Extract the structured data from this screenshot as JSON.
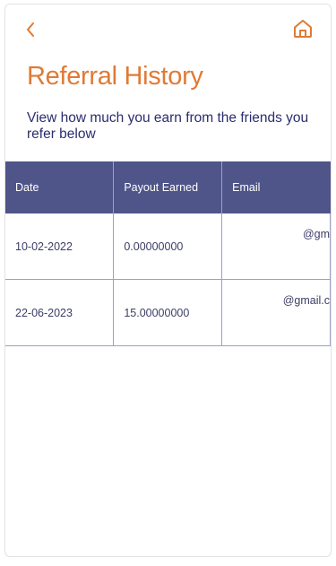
{
  "header": {
    "back_icon": "chevron-left-icon",
    "home_icon": "home-icon",
    "accent_color": "#e07a35"
  },
  "title": "Referral History",
  "subtitle": "View how much you earn from the friends you refer below",
  "table": {
    "columns": [
      "Date",
      "Payout Earned",
      "Email"
    ],
    "rows": [
      {
        "date": "10-02-2022",
        "payout": "0.00000000",
        "email": "@gm"
      },
      {
        "date": "22-06-2023",
        "payout": "15.00000000",
        "email": "@gmail.c"
      }
    ],
    "header_color": "#4f5588"
  }
}
